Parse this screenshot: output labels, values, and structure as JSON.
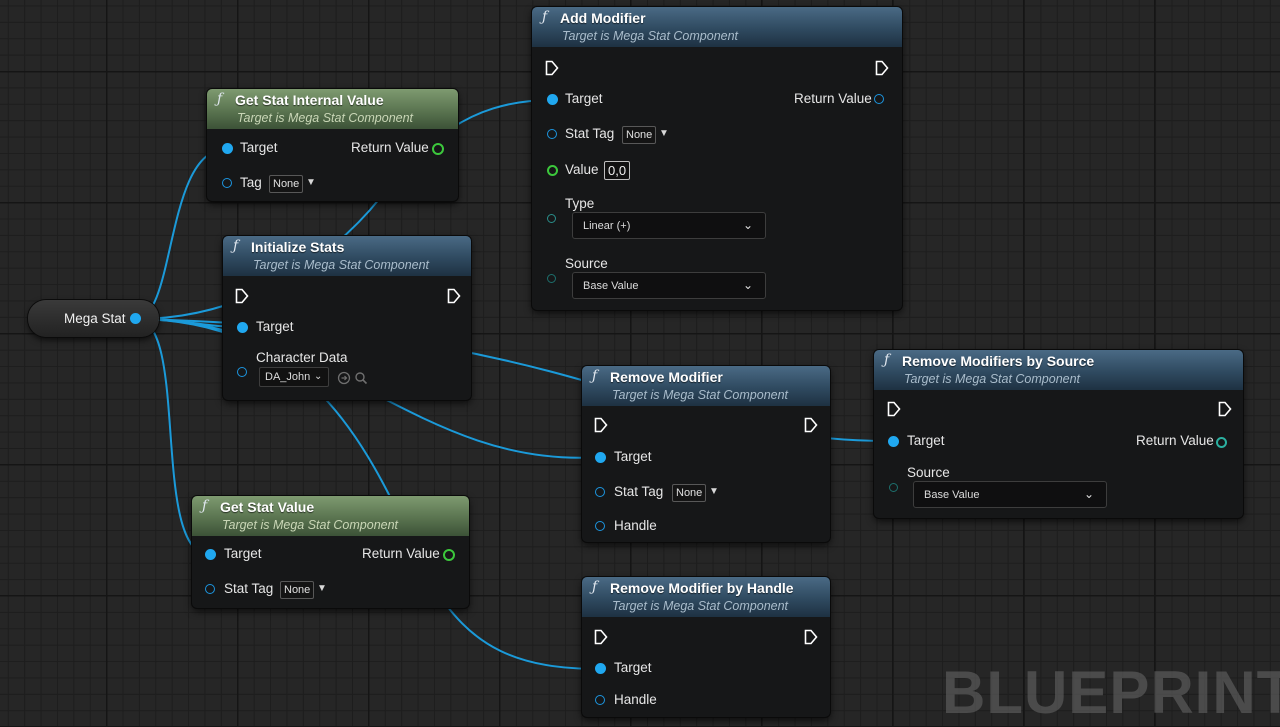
{
  "graph_type": "Blueprint event graph",
  "watermark": "BLUEPRINT",
  "colors": {
    "object_pin": "#20a8f0",
    "float_pin": "#3cc83c",
    "byte_pin": "#2a8e8a",
    "exec_pin": "#ffffff",
    "function_header": "#3c5a74",
    "pure_function_header": "#6a8a5c",
    "grid_background": "#262626"
  },
  "variable": {
    "label": "Mega Stat"
  },
  "nodes": {
    "add_modifier": {
      "icon": "function-icon",
      "title": "Add Modifier",
      "subtitle": "Target is Mega Stat Component",
      "target": "Target",
      "return_value": "Return Value",
      "stat_tag": "Stat Tag",
      "stat_tag_value": "None",
      "value": "Value",
      "value_default": "0,0",
      "type": "Type",
      "type_value": "Linear (+)",
      "source": "Source",
      "source_value": "Base Value"
    },
    "get_stat_internal_value": {
      "icon": "function-icon",
      "title": "Get Stat Internal Value",
      "subtitle": "Target is Mega Stat Component",
      "target": "Target",
      "return_value": "Return Value",
      "tag": "Tag",
      "tag_value": "None"
    },
    "initialize_stats": {
      "icon": "function-icon",
      "title": "Initialize Stats",
      "subtitle": "Target is Mega Stat Component",
      "target": "Target",
      "character_data": "Character Data",
      "character_data_value": "DA_John"
    },
    "remove_modifier": {
      "icon": "function-icon",
      "title": "Remove Modifier",
      "subtitle": "Target is Mega Stat Component",
      "target": "Target",
      "stat_tag": "Stat Tag",
      "stat_tag_value": "None",
      "handle": "Handle"
    },
    "remove_modifiers_by_source": {
      "icon": "function-icon",
      "title": "Remove Modifiers by Source",
      "subtitle": "Target is Mega Stat Component",
      "target": "Target",
      "return_value": "Return Value",
      "source": "Source",
      "source_value": "Base Value"
    },
    "get_stat_value": {
      "icon": "function-icon",
      "title": "Get Stat Value",
      "subtitle": "Target is Mega Stat Component",
      "target": "Target",
      "return_value": "Return Value",
      "stat_tag": "Stat Tag",
      "stat_tag_value": "None"
    },
    "remove_modifier_by_handle": {
      "icon": "function-icon",
      "title": "Remove Modifier by Handle",
      "subtitle": "Target is Mega Stat Component",
      "target": "Target",
      "handle": "Handle"
    }
  }
}
